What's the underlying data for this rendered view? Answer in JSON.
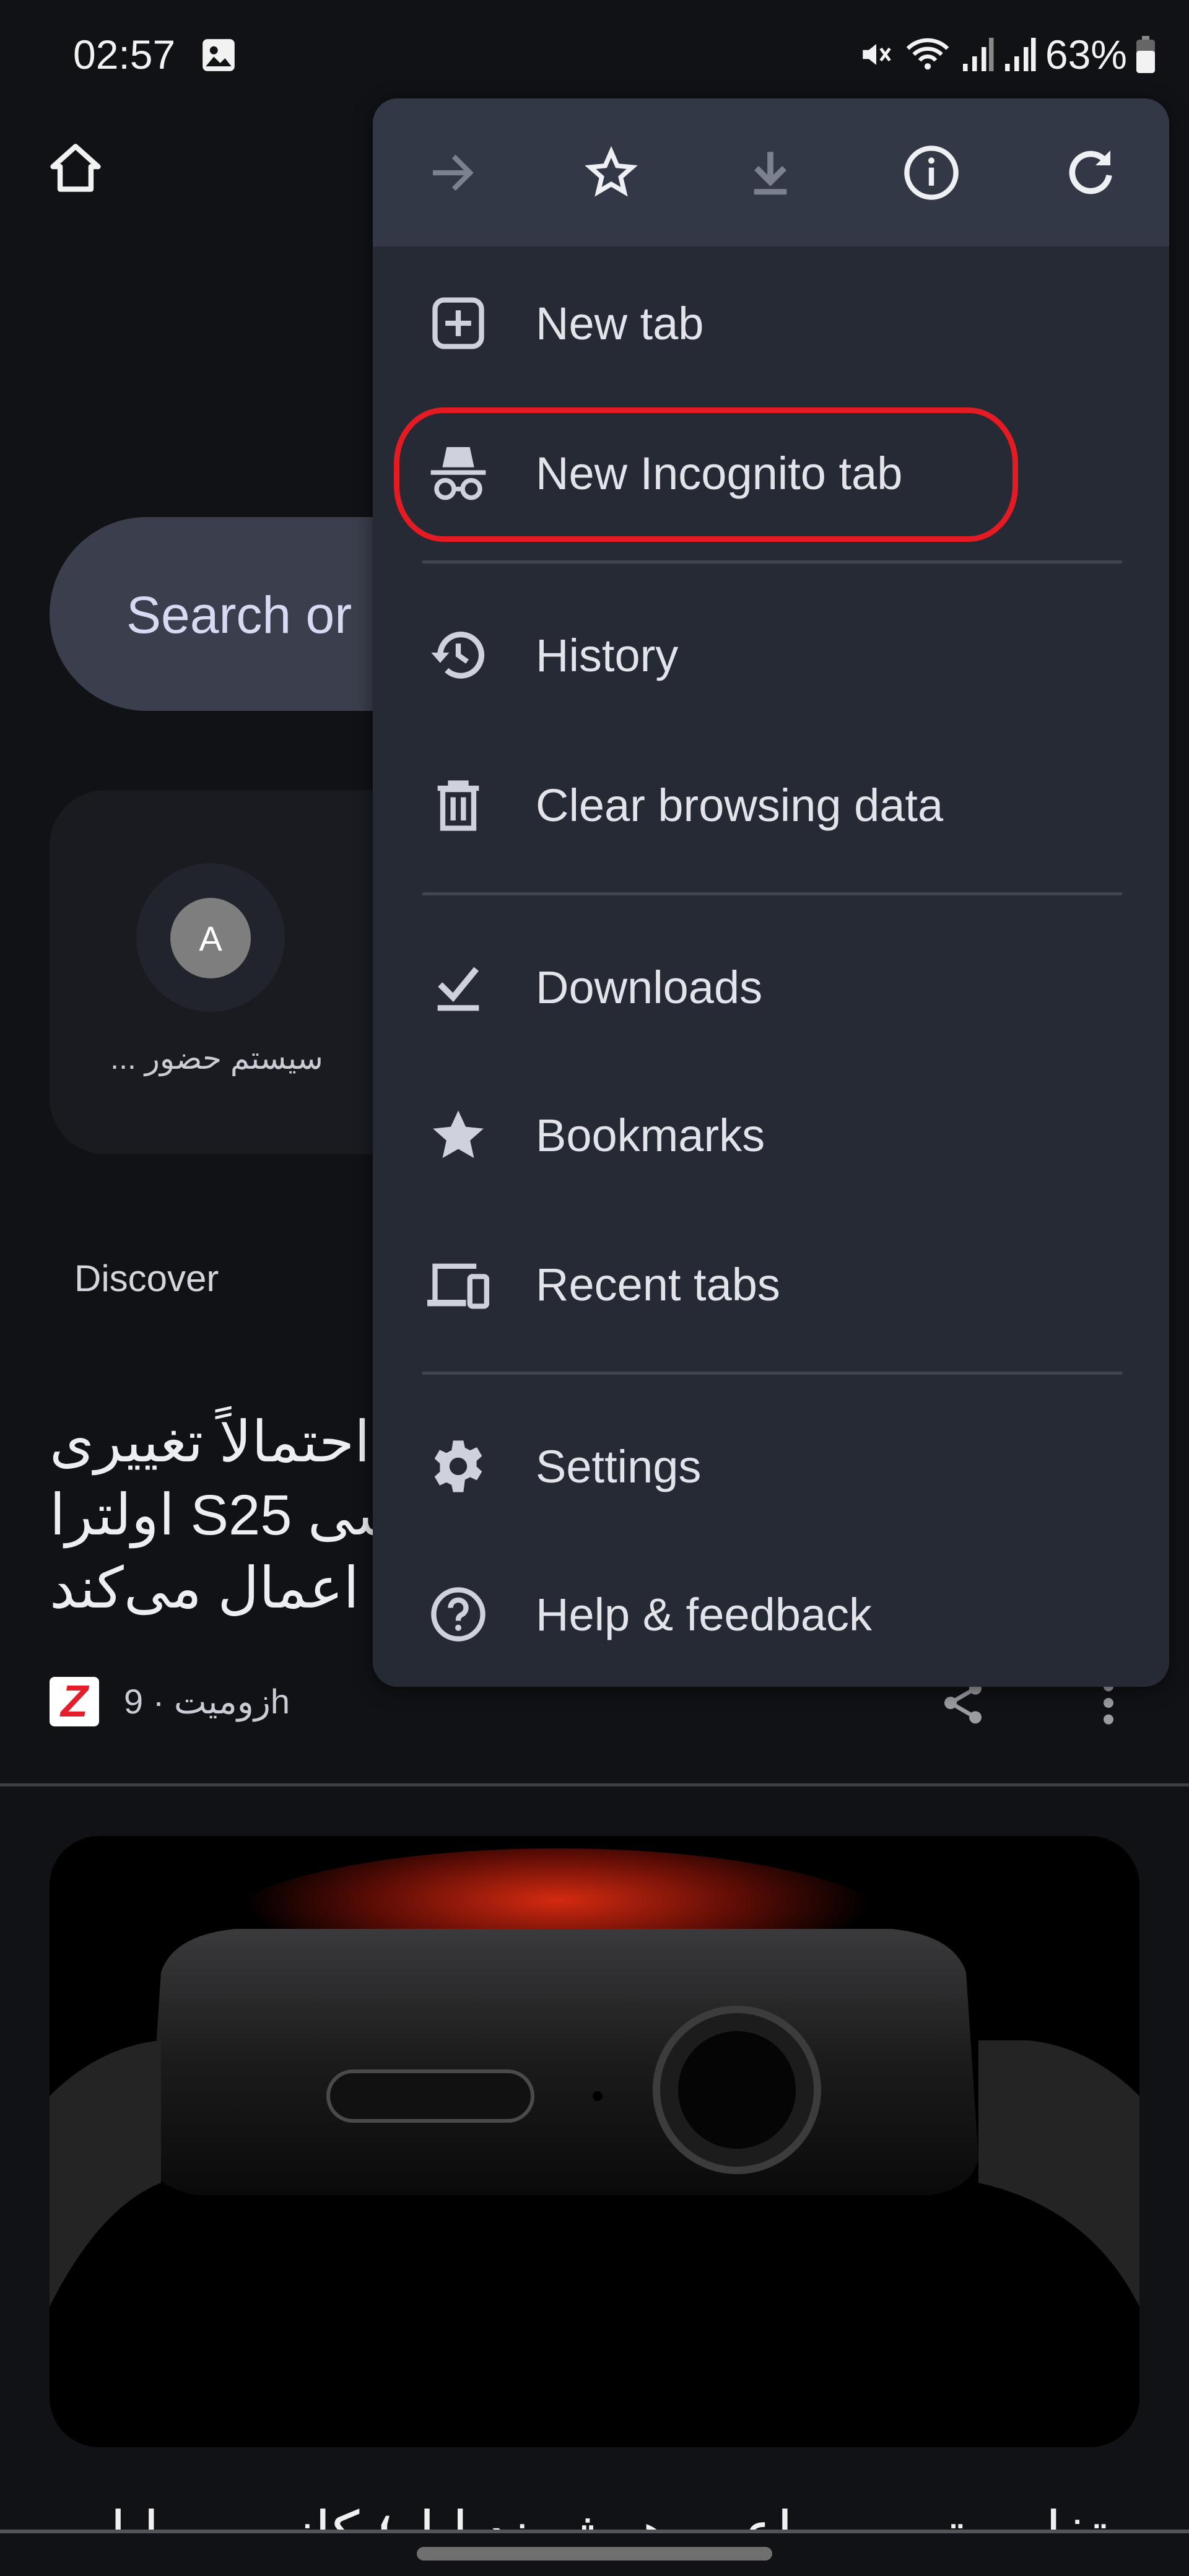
{
  "status_bar": {
    "time": "02:57",
    "battery": "63%",
    "icons": [
      "gallery-icon",
      "mute-icon",
      "wifi-icon",
      "signal-icon",
      "signal-icon",
      "battery-icon"
    ]
  },
  "new_tab_page": {
    "search_placeholder": "Search or",
    "shortcut": {
      "avatar_letter": "A",
      "label": "سیستم حضور ..."
    },
    "discover_label": "Discover",
    "article": {
      "title_lines": [
        "احتمالاً تغییری",
        "سی S25 اولترا",
        "اعمال می‌کند"
      ],
      "source": "زومیت",
      "age": "9h",
      "source_logo_letter": "Z"
    },
    "next_article_title": "متفاوت‌ترین ساعت هوشمند اپل؛ کانسپت اپل واچ"
  },
  "menu": {
    "toolbar": [
      "forward-icon",
      "bookmark-star-icon",
      "download-icon",
      "info-icon",
      "refresh-icon"
    ],
    "items": [
      {
        "label": "New tab",
        "icon": "new-tab-icon"
      },
      {
        "label": "New Incognito tab",
        "icon": "incognito-icon",
        "highlighted": true
      },
      {
        "label": "History",
        "icon": "history-icon"
      },
      {
        "label": "Clear browsing data",
        "icon": "trash-icon"
      },
      {
        "label": "Downloads",
        "icon": "downloads-icon"
      },
      {
        "label": "Bookmarks",
        "icon": "star-icon"
      },
      {
        "label": "Recent tabs",
        "icon": "devices-icon"
      },
      {
        "label": "Settings",
        "icon": "gear-icon"
      },
      {
        "label": "Help & feedback",
        "icon": "help-icon"
      }
    ]
  },
  "colors": {
    "highlight": "#e41b23",
    "menu_bg": "#262a35",
    "toolbar_bg": "#333846",
    "page_bg": "#111216"
  }
}
